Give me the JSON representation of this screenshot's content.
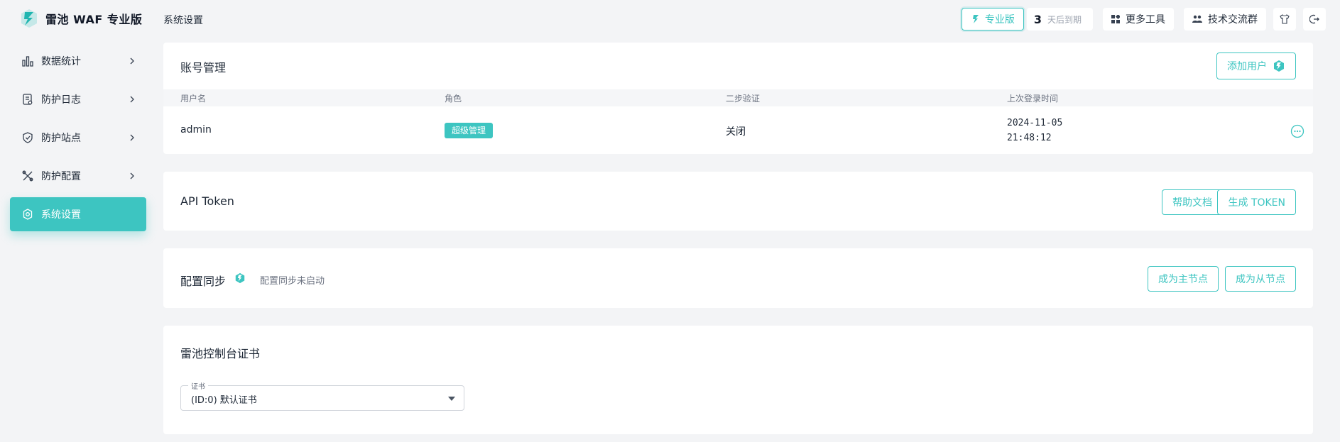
{
  "brand": {
    "name": "雷池 WAF 专业版"
  },
  "colors": {
    "accent": "#3dc5c1",
    "background": "#f3f4f6"
  },
  "sidebar": {
    "items": [
      {
        "label": "数据统计",
        "icon": "bar-chart-icon",
        "active": false
      },
      {
        "label": "防护日志",
        "icon": "log-document-icon",
        "active": false
      },
      {
        "label": "防护站点",
        "icon": "shield-icon",
        "active": false
      },
      {
        "label": "防护配置",
        "icon": "tools-icon",
        "active": false
      },
      {
        "label": "系统设置",
        "icon": "gear-icon",
        "active": true
      }
    ]
  },
  "header": {
    "page_title": "系统设置",
    "edition_badge": "专业版",
    "expire_days": "3",
    "expire_text": "天后到期",
    "more_tools": "更多工具",
    "community": "技术交流群"
  },
  "accounts": {
    "title": "账号管理",
    "add_user": "添加用户",
    "columns": [
      "用户名",
      "角色",
      "二步验证",
      "上次登录时间"
    ],
    "rows": [
      {
        "username": "admin",
        "role": "超级管理",
        "two_factor": "关闭",
        "last_login_date": "2024-11-05",
        "last_login_time": "21:48:12"
      }
    ]
  },
  "api_token": {
    "title": "API Token",
    "help_docs": "帮助文档",
    "generate": "生成 TOKEN"
  },
  "config_sync": {
    "title": "配置同步",
    "status": "配置同步未启动",
    "become_master": "成为主节点",
    "become_slave": "成为从节点"
  },
  "certificate": {
    "title": "雷池控制台证书",
    "field_label": "证书",
    "selected": "(ID:0) 默认证书"
  }
}
